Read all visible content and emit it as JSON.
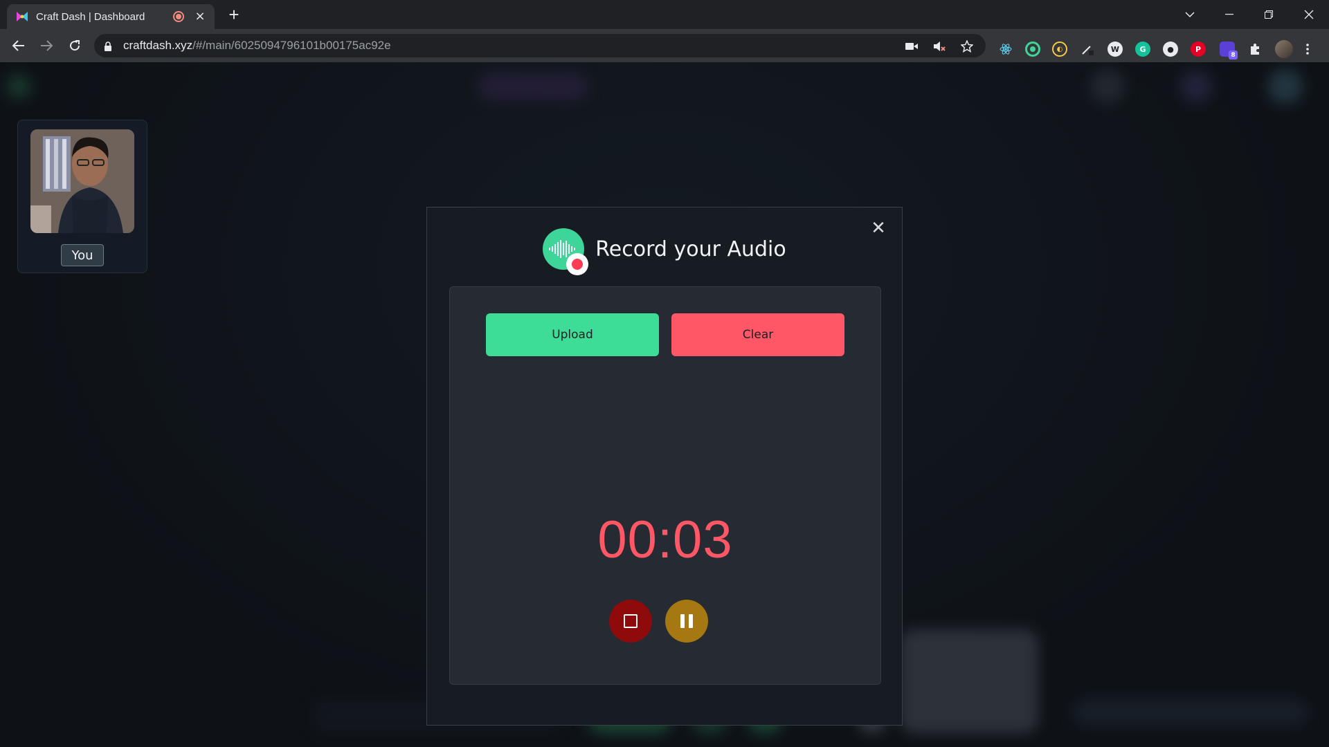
{
  "browser": {
    "tab_title": "Craft Dash | Dashboard",
    "tab_close": "×",
    "new_tab": "+",
    "url_host": "craftdash.xyz",
    "url_path": "/#/main/6025094796101b00175ac92e",
    "extension_badge": "8"
  },
  "participant": {
    "label": "You"
  },
  "modal": {
    "title": "Record your Audio",
    "close": "✕",
    "upload_label": "Upload",
    "clear_label": "Clear",
    "timer": "00:03"
  },
  "colors": {
    "accent_green": "#3ddc97",
    "danger_red": "#ff5765",
    "stop_red": "#8f0a0a",
    "pause_amber": "#a67812"
  }
}
